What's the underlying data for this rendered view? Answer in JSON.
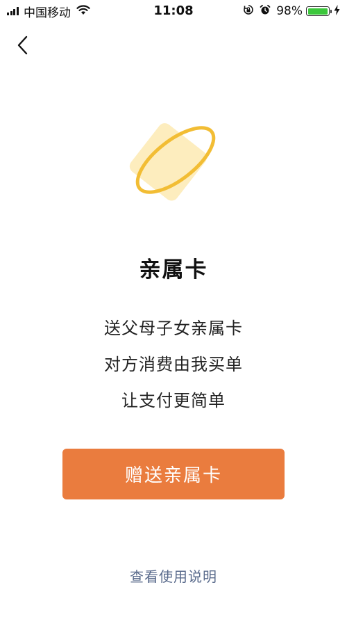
{
  "status_bar": {
    "carrier": "中国移动",
    "time": "11:08",
    "battery_percent": "98%",
    "battery_level": 0.98,
    "icons": [
      "signal-icon",
      "wifi-icon",
      "rotation-lock-icon",
      "alarm-icon",
      "battery-icon",
      "charging-icon"
    ]
  },
  "nav": {
    "back_icon": "chevron-left-icon"
  },
  "hero": {
    "icon": "card-orbit-icon",
    "colors": {
      "card": "#fdedbe",
      "ring": "#f2bd34"
    }
  },
  "content": {
    "title": "亲属卡",
    "lines": [
      "送父母子女亲属卡",
      "对方消费由我买单",
      "让支付更简单"
    ]
  },
  "actions": {
    "gift_button": "赠送亲属卡",
    "help_link": "查看使用说明"
  },
  "colors": {
    "primary_button": "#ea7c3e",
    "link": "#5a6b8c"
  }
}
